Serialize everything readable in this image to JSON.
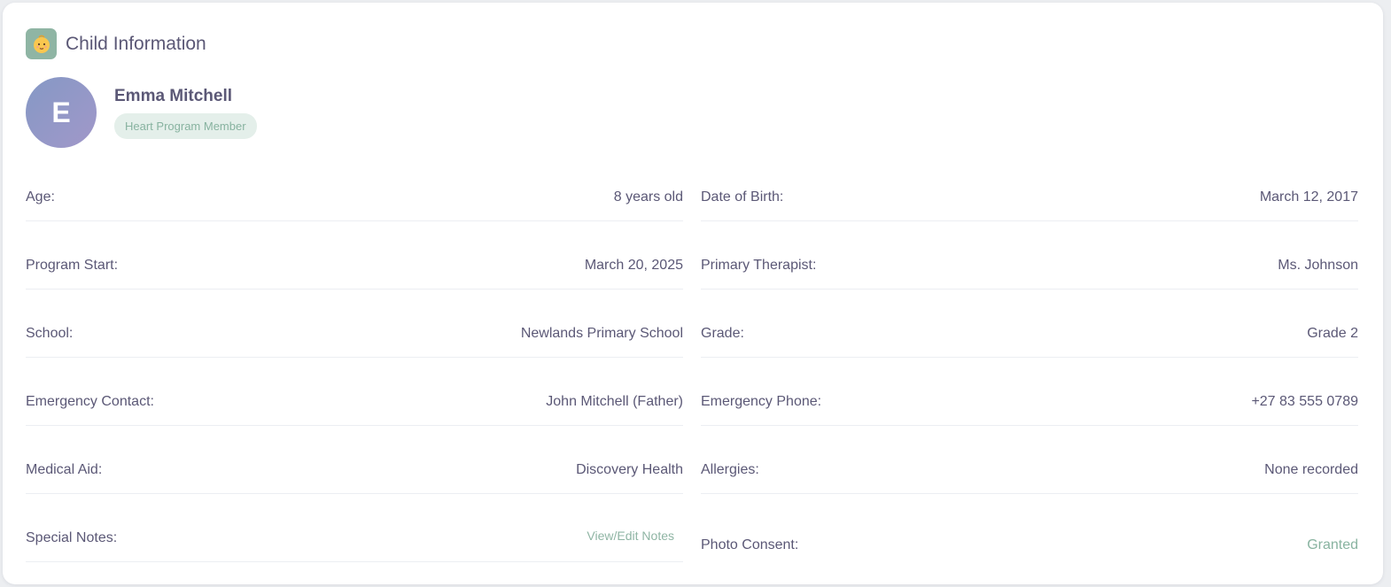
{
  "header": {
    "icon": "baby-face-icon",
    "title": "Child Information"
  },
  "profile": {
    "initial": "E",
    "name": "Emma Mitchell",
    "badge": "Heart Program Member"
  },
  "rows": [
    {
      "left_label": "Age:",
      "left_value": "8 years old",
      "right_label": "Date of Birth:",
      "right_value": "March 12, 2017"
    },
    {
      "left_label": "Program Start:",
      "left_value": "March 20, 2025",
      "right_label": "Primary Therapist:",
      "right_value": "Ms. Johnson"
    },
    {
      "left_label": "School:",
      "left_value": "Newlands Primary School",
      "right_label": "Grade:",
      "right_value": "Grade 2"
    },
    {
      "left_label": "Emergency Contact:",
      "left_value": "John Mitchell (Father)",
      "right_label": "Emergency Phone:",
      "right_value": "+27 83 555 0789"
    },
    {
      "left_label": "Medical Aid:",
      "left_value": "Discovery Health",
      "right_label": "Allergies:",
      "right_value": "None recorded"
    },
    {
      "left_label": "Special Notes:",
      "left_value": "View/Edit Notes",
      "right_label": "Photo Consent:",
      "right_value": "Granted"
    }
  ],
  "colors": {
    "accent": "#8fb5a4",
    "text": "#5b5876",
    "avatar_start": "#8599c5",
    "avatar_end": "#a197c9"
  }
}
